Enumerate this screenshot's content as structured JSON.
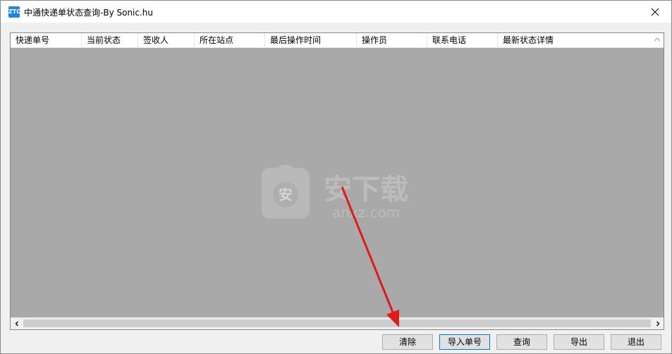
{
  "window": {
    "title": "中通快递单状态查询-By Sonic.hu",
    "icon_text": "ZTO",
    "icon_color": "#1a88e0",
    "close_glyph": "×"
  },
  "table": {
    "columns": [
      "快递单号",
      "当前状态",
      "签收人",
      "所在站点",
      "最后操作时间",
      "操作员",
      "联系电话",
      "最新状态详情"
    ],
    "rows": []
  },
  "watermark": {
    "text": "安下载",
    "subtext": "anxz.com",
    "badge": "安"
  },
  "buttons": {
    "clear": "清除",
    "import": "导入单号",
    "query": "查询",
    "export": "导出",
    "exit": "退出"
  },
  "colors": {
    "list_background": "#a9a9a9",
    "annotation_arrow": "#e01a1a",
    "focus_border": "#0078d7"
  }
}
